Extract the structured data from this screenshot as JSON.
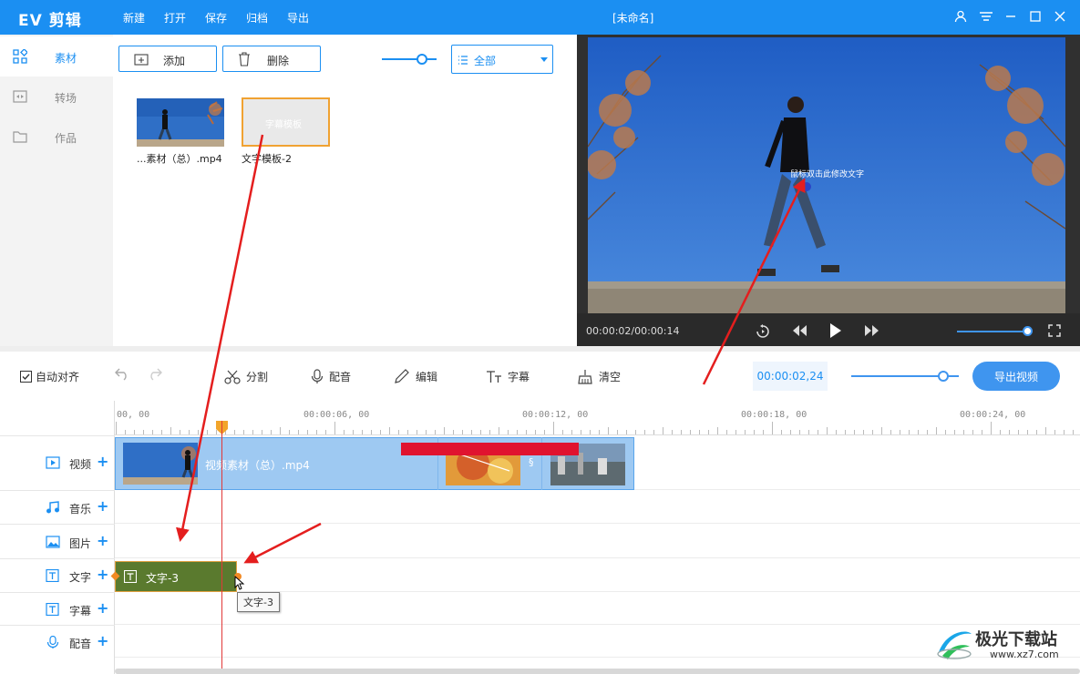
{
  "app": {
    "name": "EV 剪辑",
    "doc_title": "[未命名]"
  },
  "menu": [
    "新建",
    "打开",
    "保存",
    "归档",
    "导出"
  ],
  "sidebar": {
    "items": [
      {
        "label": "素材",
        "icon": "grid-icon",
        "active": true
      },
      {
        "label": "转场",
        "icon": "transition-icon",
        "active": false
      },
      {
        "label": "作品",
        "icon": "folder-icon",
        "active": false
      }
    ]
  },
  "media": {
    "add_label": "添加",
    "delete_label": "删除",
    "filter_value": "全部",
    "items": [
      {
        "caption": "...素材（总）.mp4"
      },
      {
        "caption": "文字模板-2",
        "overlay": "字幕模板"
      }
    ]
  },
  "preview": {
    "overlay_text": "鼠标双击此修改文字",
    "time": "00:00:02/00:00:14"
  },
  "toolbar": {
    "auto_align": "自动对齐",
    "split": "分割",
    "voice": "配音",
    "edit": "编辑",
    "subtitle": "字幕",
    "clear": "清空",
    "timecode": "00:00:02,24",
    "export": "导出视频"
  },
  "ruler": [
    "00, 00",
    "00:00:06, 00",
    "00:00:12, 00",
    "00:00:18, 00",
    "00:00:24, 00"
  ],
  "tracks": [
    {
      "label": "视频",
      "icon": "video-icon"
    },
    {
      "label": "音乐",
      "icon": "music-icon"
    },
    {
      "label": "图片",
      "icon": "image-icon"
    },
    {
      "label": "文字",
      "icon": "text-icon"
    },
    {
      "label": "字幕",
      "icon": "subtitle-icon"
    },
    {
      "label": "配音",
      "icon": "mic-icon"
    }
  ],
  "clips": {
    "video": "视频素材（总）.mp4",
    "text": "文字-3"
  },
  "tooltip": "文字-3",
  "watermark": {
    "name": "极光下载站",
    "url": "www.xz7.com"
  }
}
